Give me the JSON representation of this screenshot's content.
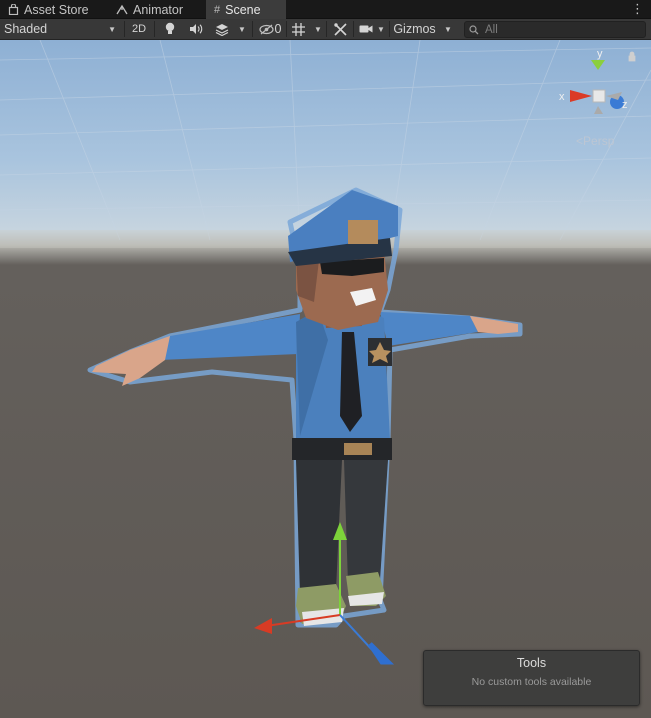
{
  "tabs": [
    {
      "label": "Asset Store",
      "icon": "shopping-bag-icon",
      "active": false
    },
    {
      "label": "Animator",
      "icon": "animator-icon",
      "active": false
    },
    {
      "label": "Scene",
      "icon": "grid-hash-icon",
      "active": true
    }
  ],
  "toolbar": {
    "draw_mode": "Shaded",
    "mode_2d": "2D",
    "hidden_count": "0",
    "gizmos": "Gizmos",
    "search_placeholder": "All"
  },
  "viewport": {
    "projection": "Persp",
    "axes": {
      "x": "x",
      "y": "y",
      "z": "z"
    },
    "axis_colors": {
      "x": "#db3b26",
      "y": "#8bcf3d",
      "z": "#3a7bd5"
    }
  },
  "tools_overlay": {
    "title": "Tools",
    "message": "No custom tools available"
  }
}
